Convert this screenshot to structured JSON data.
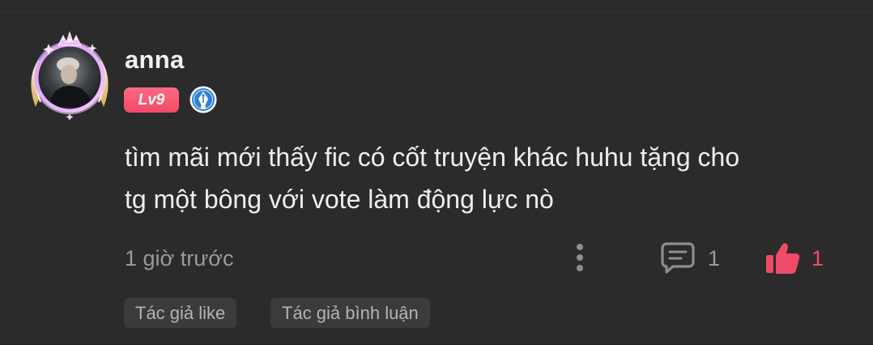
{
  "comment": {
    "author": "anna",
    "level": "Lv9",
    "text_lines": [
      "tìm mãi mới thấy fic có cốt truyện khác huhu tặng cho",
      "tg một bông với vote làm động lực nò"
    ],
    "time": "1 giờ trước",
    "reply_count": "1",
    "like_count": "1",
    "tags": [
      "Tác giả like",
      "Tác giả bình luận"
    ]
  },
  "icons": {
    "avatar_frame": "winged-crown-frame",
    "author_badge": "fountain-pen-badge-icon",
    "more": "vertical-dots-icon",
    "reply": "speech-bubble-icon",
    "like": "thumbs-up-icon"
  },
  "colors": {
    "background": "#2b2b2b",
    "accent": "#f04b66",
    "level_badge": "#f24866",
    "author_badge": "#2f7fd6",
    "muted_text": "#9a9a9a",
    "tag_bg": "#3b3b3b"
  }
}
